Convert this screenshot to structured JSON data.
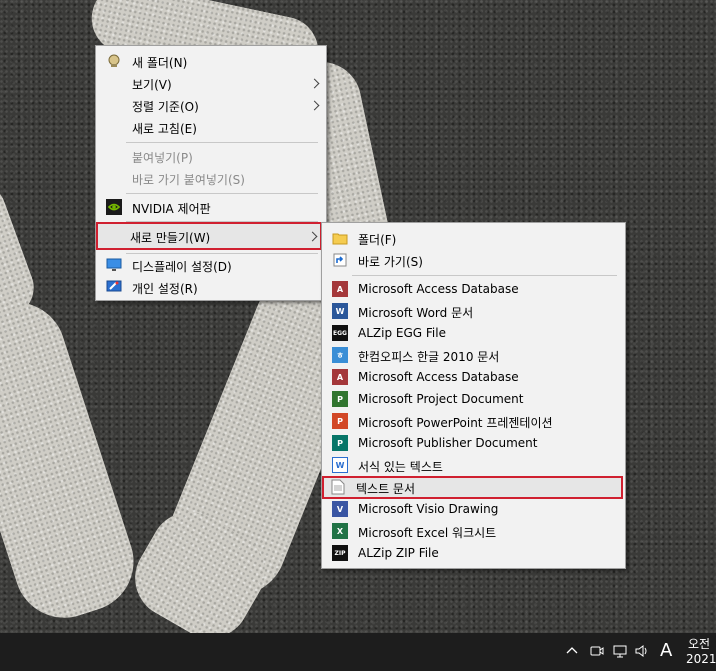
{
  "context_menu": {
    "items": [
      {
        "label": "새 폴더(N)",
        "icon": "new-folder-icon"
      },
      {
        "label": "보기(V)"
      },
      {
        "label": "정렬 기준(O)"
      },
      {
        "label": "새로 고침(E)"
      },
      {
        "label": "붙여넣기(P)"
      },
      {
        "label": "바로 가기 붙여넣기(S)"
      },
      {
        "label": "NVIDIA 제어판",
        "icon": "nvidia-icon"
      },
      {
        "label": "새로 만들기(W)"
      },
      {
        "label": "디스플레이 설정(D)",
        "icon": "display-icon"
      },
      {
        "label": "개인 설정(R)",
        "icon": "personalize-icon"
      }
    ]
  },
  "submenu": {
    "items": [
      {
        "label": "폴더(F)",
        "icon": "folder-icon"
      },
      {
        "label": "바로 가기(S)",
        "icon": "shortcut-icon"
      },
      {
        "label": "Microsoft Access Database",
        "icon": "access-icon"
      },
      {
        "label": "Microsoft Word 문서",
        "icon": "word-icon"
      },
      {
        "label": "ALZip EGG File",
        "icon": "egg-icon"
      },
      {
        "label": "한컴오피스 한글 2010 문서",
        "icon": "hwp-icon"
      },
      {
        "label": "Microsoft Access Database",
        "icon": "access-icon"
      },
      {
        "label": "Microsoft Project Document",
        "icon": "project-icon"
      },
      {
        "label": "Microsoft PowerPoint 프레젠테이션",
        "icon": "powerpoint-icon"
      },
      {
        "label": "Microsoft Publisher Document",
        "icon": "publisher-icon"
      },
      {
        "label": "서식 있는 텍스트",
        "icon": "wordpad-icon"
      },
      {
        "label": "텍스트 문서",
        "icon": "text-document-icon"
      },
      {
        "label": "Microsoft Visio Drawing",
        "icon": "visio-icon"
      },
      {
        "label": "Microsoft Excel 워크시트",
        "icon": "excel-icon"
      },
      {
        "label": "ALZip ZIP File",
        "icon": "zip-icon"
      }
    ]
  },
  "taskbar": {
    "ime": "A",
    "time": "오전",
    "date": "2021"
  },
  "colors": {
    "highlight_border": "#d02030",
    "menu_bg": "#f2f2f2",
    "taskbar_bg": "#1d1d1d"
  }
}
